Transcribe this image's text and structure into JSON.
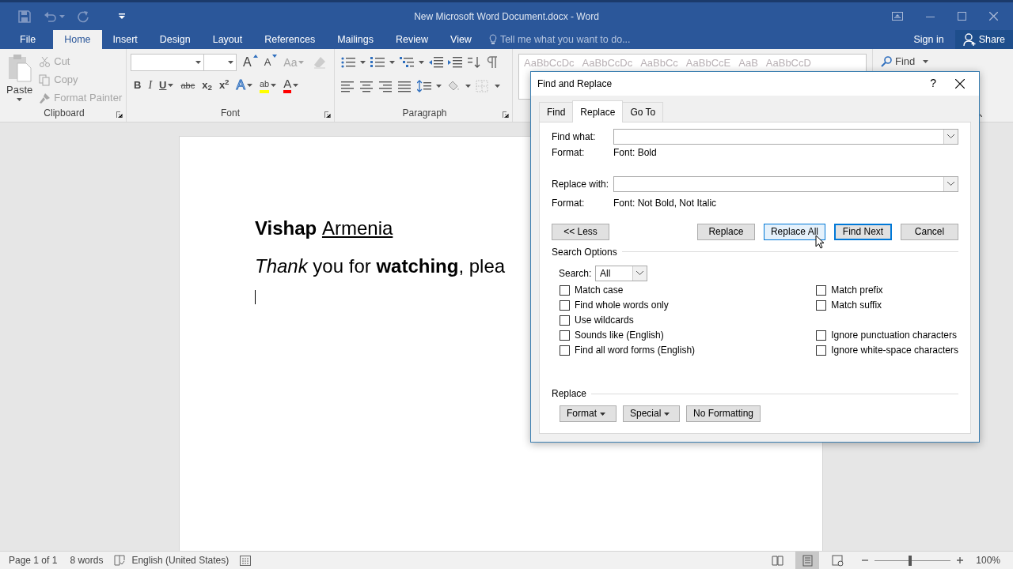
{
  "title_bar": {
    "title": "New Microsoft Word Document.docx - Word"
  },
  "ribbon_tabs": [
    {
      "label": "File",
      "selected": false
    },
    {
      "label": "Home",
      "selected": true
    },
    {
      "label": "Insert",
      "selected": false
    },
    {
      "label": "Design",
      "selected": false
    },
    {
      "label": "Layout",
      "selected": false
    },
    {
      "label": "References",
      "selected": false
    },
    {
      "label": "Mailings",
      "selected": false
    },
    {
      "label": "Review",
      "selected": false
    },
    {
      "label": "View",
      "selected": false
    }
  ],
  "tell_me": {
    "placeholder": "Tell me what you want to do..."
  },
  "account": {
    "sign_in": "Sign in",
    "share": "Share"
  },
  "clipboard": {
    "label": "Clipboard",
    "paste": "Paste",
    "items": [
      {
        "kind": "cut",
        "label": "Cut",
        "disabled": true
      },
      {
        "kind": "copy",
        "label": "Copy",
        "disabled": true
      },
      {
        "kind": "painter",
        "label": "Format Painter",
        "disabled": true
      }
    ]
  },
  "font_group": {
    "label": "Font",
    "row1": [
      {
        "kind": "grow",
        "label": "A",
        "dropdown": false,
        "disabled": false
      },
      {
        "kind": "shrink",
        "label": "A",
        "dropdown": false,
        "disabled": false
      },
      {
        "kind": "case",
        "label": "Aa",
        "dropdown": true,
        "disabled": true
      }
    ],
    "row2": [
      {
        "kind": "bold",
        "label": "B",
        "dropdown": false
      },
      {
        "kind": "italic",
        "label": "I",
        "dropdown": false
      },
      {
        "kind": "underline",
        "label": "U",
        "dropdown": true
      },
      {
        "kind": "strike",
        "label": "abc",
        "dropdown": false
      },
      {
        "kind": "sub",
        "label": "x$_{2}$",
        "dropdown": false
      },
      {
        "kind": "sup",
        "label": "x$^{2}$",
        "dropdown": false
      },
      {
        "kind": "effects",
        "label": "A",
        "dropdown": true
      },
      {
        "kind": "highlight",
        "label": "ab",
        "dropdown": true,
        "color": "#ffff00"
      },
      {
        "kind": "fontcolor",
        "label": "A",
        "dropdown": true,
        "color": "#ff0000"
      }
    ]
  },
  "paragraph_group": {
    "label": "Paragraph"
  },
  "styles": {
    "samples": [
      "AaBbCcDc",
      "AaBbCcDc",
      "AaBbCc",
      "AaBbCcE",
      "AaB",
      "AaBbCcD"
    ]
  },
  "editing": {
    "find": "Find"
  },
  "document": {
    "lines": [
      [
        {
          "text": "Vishap ",
          "kind": "strong"
        },
        {
          "text": "Armenia",
          "kind": "underlined"
        }
      ],
      [
        {
          "text": "Thank",
          "kind": "emphasis"
        },
        {
          "text": " you for ",
          "kind": "normal"
        },
        {
          "text": "watching",
          "kind": "strong"
        },
        {
          "text": ", plea",
          "kind": "normal"
        }
      ]
    ]
  },
  "dialog": {
    "title": "Find and Replace",
    "help": "?",
    "tabs": [
      {
        "label": "Find",
        "selected": false
      },
      {
        "label": "Replace",
        "selected": true
      },
      {
        "label": "Go To",
        "selected": false
      }
    ],
    "fields": [
      {
        "label": "Find what:",
        "format_label": "Format:",
        "format": "Font: Bold"
      },
      {
        "label": "Replace with:",
        "format_label": "Format:",
        "format": "Font: Not Bold, Not Italic"
      }
    ],
    "less_button": "<< Less",
    "buttons": [
      {
        "label": "Replace",
        "hovered": false,
        "default": false
      },
      {
        "label": "Replace All",
        "hovered": true,
        "default": false
      },
      {
        "label": "Find Next",
        "hovered": false,
        "default": true
      },
      {
        "label": "Cancel",
        "hovered": false,
        "default": false
      }
    ],
    "search_options": {
      "title": "Search Options",
      "search_label": "Search:",
      "search_value": "All",
      "left": [
        {
          "label": "Match case",
          "checked": false
        },
        {
          "label": "Find whole words only",
          "checked": false
        },
        {
          "label": "Use wildcards",
          "checked": false
        },
        {
          "label": "Sounds like (English)",
          "checked": false
        },
        {
          "label": "Find all word forms (English)",
          "checked": false
        }
      ],
      "right": [
        [
          {
            "label": "Match prefix",
            "checked": false
          },
          {
            "label": "Match suffix",
            "checked": false
          }
        ],
        [
          {
            "label": "Ignore punctuation characters",
            "checked": false
          },
          {
            "label": "Ignore white-space characters",
            "checked": false
          }
        ]
      ]
    },
    "replace_section": {
      "title": "Replace",
      "buttons": [
        {
          "label": "Format",
          "dropdown": true
        },
        {
          "label": "Special",
          "dropdown": true
        },
        {
          "label": "No Formatting",
          "dropdown": false
        }
      ]
    }
  },
  "status_bar": {
    "page": "Page 1 of 1",
    "words": "8 words",
    "language": "English (United States)",
    "views": [
      {
        "kind": "read",
        "selected": false
      },
      {
        "kind": "print",
        "selected": true
      },
      {
        "kind": "web",
        "selected": false
      }
    ],
    "zoom": {
      "level": 0.47,
      "reading": "100%"
    }
  }
}
